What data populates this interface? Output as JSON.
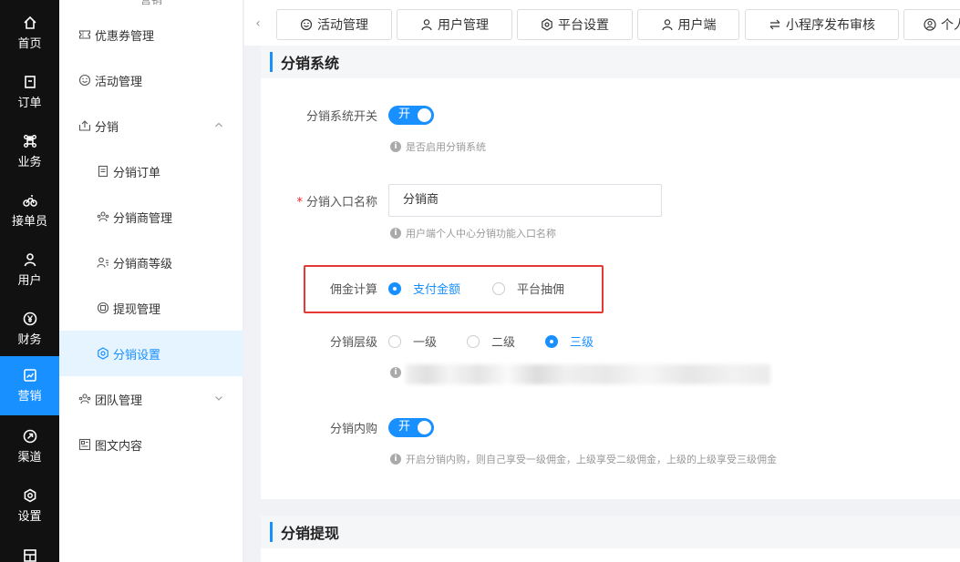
{
  "rail": {
    "items": [
      {
        "label": "首页",
        "icon": "home-icon"
      },
      {
        "label": "订单",
        "icon": "order-icon"
      },
      {
        "label": "业务",
        "icon": "command-icon"
      },
      {
        "label": "接单员",
        "icon": "bicycle-icon"
      },
      {
        "label": "用户",
        "icon": "user-icon"
      },
      {
        "label": "财务",
        "icon": "yen-icon"
      },
      {
        "label": "营销",
        "icon": "chart-icon",
        "active": true
      },
      {
        "label": "渠道",
        "icon": "channel-icon"
      },
      {
        "label": "设置",
        "icon": "gear-icon"
      }
    ]
  },
  "submenu": {
    "group_title": "营销",
    "items": [
      {
        "label": "优惠券管理",
        "icon": "ticket-icon",
        "level": 1
      },
      {
        "label": "活动管理",
        "icon": "smile-icon",
        "level": 1
      },
      {
        "label": "分销",
        "icon": "share-icon",
        "level": 1,
        "expanded": true
      },
      {
        "label": "分销订单",
        "icon": "document-icon",
        "level": 2
      },
      {
        "label": "分销商管理",
        "icon": "team-icon",
        "level": 2
      },
      {
        "label": "分销商等级",
        "icon": "user-list-icon",
        "level": 2
      },
      {
        "label": "提现管理",
        "icon": "withdraw-icon",
        "level": 2
      },
      {
        "label": "分销设置",
        "icon": "hexagon-gear-icon",
        "level": 2,
        "active": true
      },
      {
        "label": "团队管理",
        "icon": "team-icon",
        "level": 1,
        "expanded": false
      },
      {
        "label": "图文内容",
        "icon": "article-icon",
        "level": 1
      }
    ]
  },
  "tabs": [
    {
      "label": "活动管理",
      "icon": "smile-icon"
    },
    {
      "label": "用户管理",
      "icon": "user-icon"
    },
    {
      "label": "平台设置",
      "icon": "hexagon-gear-icon"
    },
    {
      "label": "用户端",
      "icon": "user-icon"
    },
    {
      "label": "小程序发布审核",
      "icon": "swap-icon"
    },
    {
      "label": "个人",
      "icon": "user-circle-icon"
    }
  ],
  "section1": {
    "title": "分销系统",
    "switch_label": "分销系统开关",
    "switch_state": "开",
    "switch_hint": "是否启用分销系统",
    "entry_label": "分销入口名称",
    "entry_value": "分销商",
    "entry_hint": "用户端个人中心分销功能入口名称",
    "commission_label": "佣金计算",
    "commission_options": [
      "支付金额",
      "平台抽佣"
    ],
    "commission_selected": "支付金额",
    "level_label": "分销层级",
    "level_options": [
      "一级",
      "二级",
      "三级"
    ],
    "level_selected": "三级",
    "internal_label": "分销内购",
    "internal_state": "开",
    "internal_hint": "开启分销内购，则自己享受一级佣金，上级享受二级佣金，上级的上级享受三级佣金"
  },
  "section2": {
    "title": "分销提现"
  },
  "colors": {
    "accent": "#1890ff",
    "rail_bg": "#111111",
    "highlight_box": "#e53935"
  }
}
